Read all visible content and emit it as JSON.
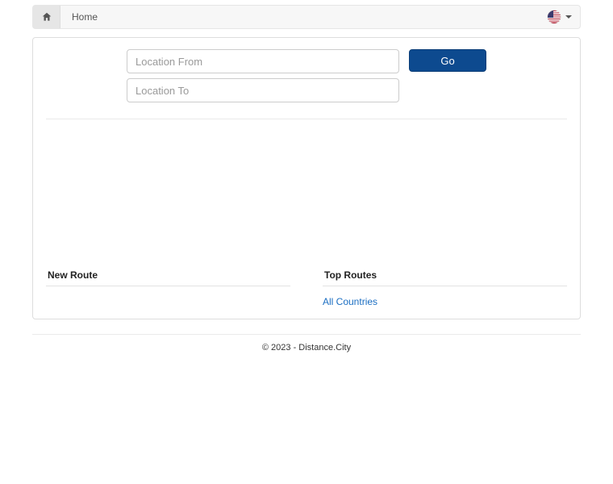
{
  "nav": {
    "home_label": "Home"
  },
  "search": {
    "from_placeholder": "Location From",
    "to_placeholder": "Location To",
    "go_label": "Go"
  },
  "sections": {
    "new_route_heading": "New Route",
    "top_routes_heading": "Top Routes",
    "all_countries_link": "All Countries"
  },
  "footer": {
    "text": "© 2023 - Distance.City"
  }
}
